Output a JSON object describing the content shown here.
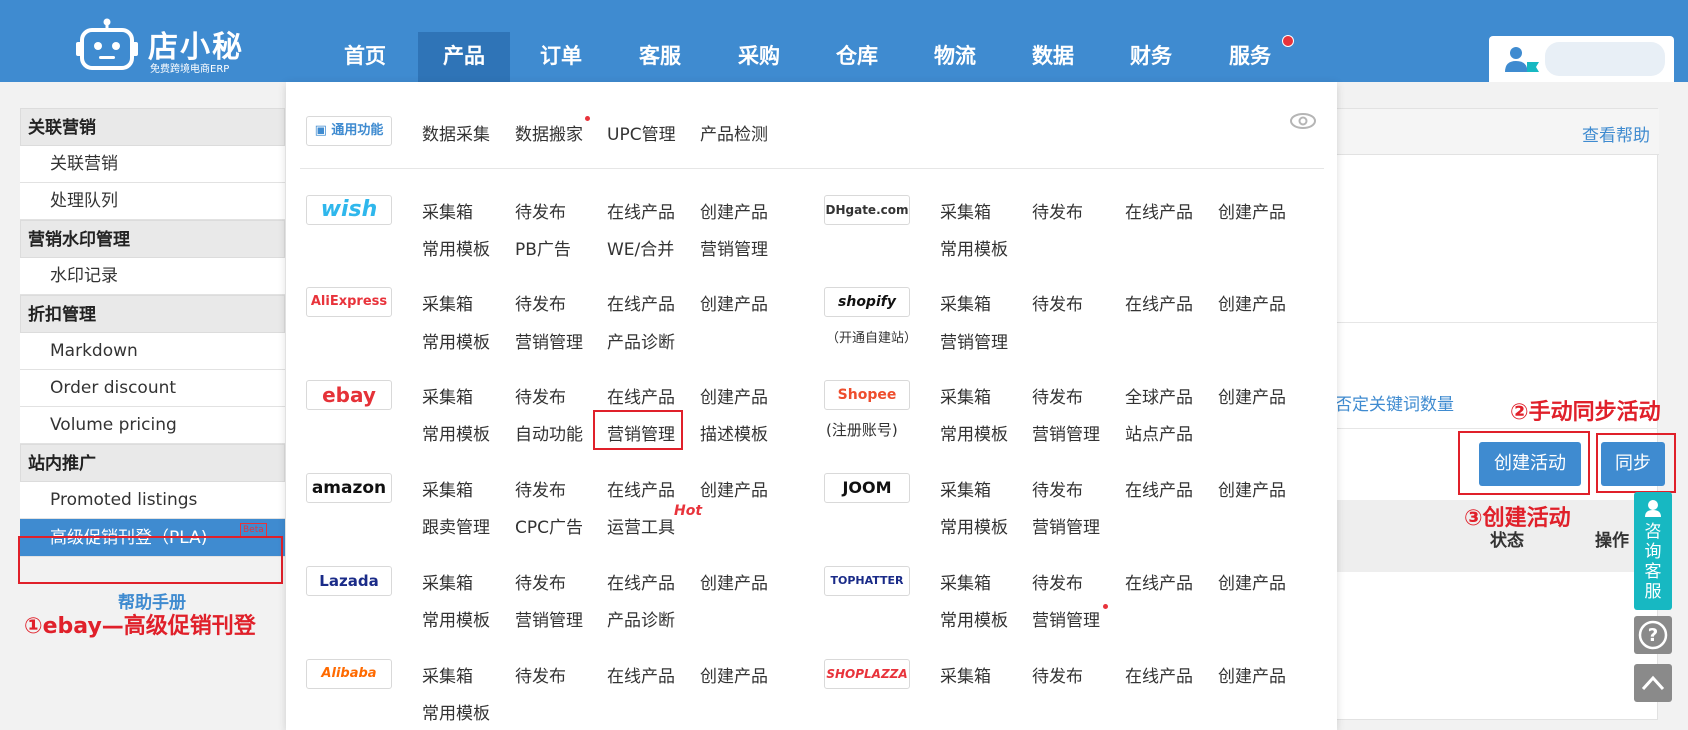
{
  "app": {
    "logo_name": "店小秘",
    "logo_sub": "免费跨境电商ERP"
  },
  "nav": [
    {
      "label": "首页"
    },
    {
      "label": "产品"
    },
    {
      "label": "订单"
    },
    {
      "label": "客服"
    },
    {
      "label": "采购"
    },
    {
      "label": "仓库"
    },
    {
      "label": "物流"
    },
    {
      "label": "数据"
    },
    {
      "label": "财务"
    },
    {
      "label": "服务"
    }
  ],
  "sidebar": {
    "groups": [
      {
        "title": "关联营销",
        "items": [
          "关联营销",
          "处理队列"
        ]
      },
      {
        "title": "营销水印管理",
        "items": [
          "水印记录"
        ]
      },
      {
        "title": "折扣管理",
        "items": [
          "Markdown",
          "Order discount",
          "Volume pricing"
        ]
      },
      {
        "title": "站内推广",
        "items": [
          "Promoted listings",
          "高级促销刊登（PLA)"
        ]
      }
    ],
    "beta": "Beta",
    "help_manual": "帮助手册"
  },
  "main": {
    "help_link": "查看帮助",
    "keyword_link": "否定关键词数量",
    "create_button": "创建活动",
    "sync_button": "同步",
    "col_status": "状态",
    "col_op": "操作"
  },
  "annotations": {
    "a1": "①ebay—高级促销刊登",
    "a2": "②手动同步活动",
    "a3": "③创建活动"
  },
  "float": {
    "consult": [
      "咨",
      "询",
      "客",
      "服"
    ]
  },
  "dropdown": {
    "general": {
      "badge": "通用功能",
      "links": [
        "数据采集",
        "数据搬家",
        "UPC管理",
        "产品检测"
      ]
    },
    "platforms_left": [
      {
        "name": "wish",
        "row1": [
          "采集箱",
          "待发布",
          "在线产品",
          "创建产品"
        ],
        "row2": [
          "常用模板",
          "PB广告",
          "WE/合并",
          "营销管理"
        ]
      },
      {
        "name": "AliExpress",
        "row1": [
          "采集箱",
          "待发布",
          "在线产品",
          "创建产品"
        ],
        "row2": [
          "常用模板",
          "营销管理",
          "产品诊断"
        ]
      },
      {
        "name": "ebay",
        "row1": [
          "采集箱",
          "待发布",
          "在线产品",
          "创建产品"
        ],
        "row2": [
          "常用模板",
          "自动功能",
          "营销管理",
          "描述模板"
        ]
      },
      {
        "name": "amazon",
        "row1": [
          "采集箱",
          "待发布",
          "在线产品",
          "创建产品"
        ],
        "row2": [
          "跟卖管理",
          "CPC广告",
          "运营工具"
        ]
      },
      {
        "name": "Lazada",
        "row1": [
          "采集箱",
          "待发布",
          "在线产品",
          "创建产品"
        ],
        "row2": [
          "常用模板",
          "营销管理",
          "产品诊断"
        ]
      },
      {
        "name": "Alibaba",
        "row1": [
          "采集箱",
          "待发布",
          "在线产品",
          "创建产品"
        ],
        "row2": [
          "常用模板"
        ]
      }
    ],
    "platforms_right": [
      {
        "name": "DHgate.com",
        "note": "",
        "row1": [
          "采集箱",
          "待发布",
          "在线产品",
          "创建产品"
        ],
        "row2": [
          "常用模板"
        ]
      },
      {
        "name": "shopify",
        "note": "（开通自建站）",
        "row1": [
          "采集箱",
          "待发布",
          "在线产品",
          "创建产品"
        ],
        "row2": [
          "营销管理"
        ]
      },
      {
        "name": "Shopee",
        "note": "(注册账号)",
        "row1": [
          "采集箱",
          "待发布",
          "全球产品",
          "创建产品"
        ],
        "row2": [
          "常用模板",
          "营销管理",
          "站点产品"
        ]
      },
      {
        "name": "JOOM",
        "note": "",
        "row1": [
          "采集箱",
          "待发布",
          "在线产品",
          "创建产品"
        ],
        "row2": [
          "常用模板",
          "营销管理"
        ]
      },
      {
        "name": "TOPHATTER",
        "note": "",
        "row1": [
          "采集箱",
          "待发布",
          "在线产品",
          "创建产品"
        ],
        "row2": [
          "常用模板",
          "营销管理"
        ]
      },
      {
        "name": "SHOPLAZZA",
        "note": "",
        "row1": [
          "采集箱",
          "待发布",
          "在线产品",
          "创建产品"
        ],
        "row2": []
      }
    ],
    "hot": "Hot"
  },
  "colors": {
    "nav_bg": "#3f8bd0",
    "accent": "#3f8bd0",
    "annotation": "#e0202a",
    "consult": "#17b8c2"
  }
}
